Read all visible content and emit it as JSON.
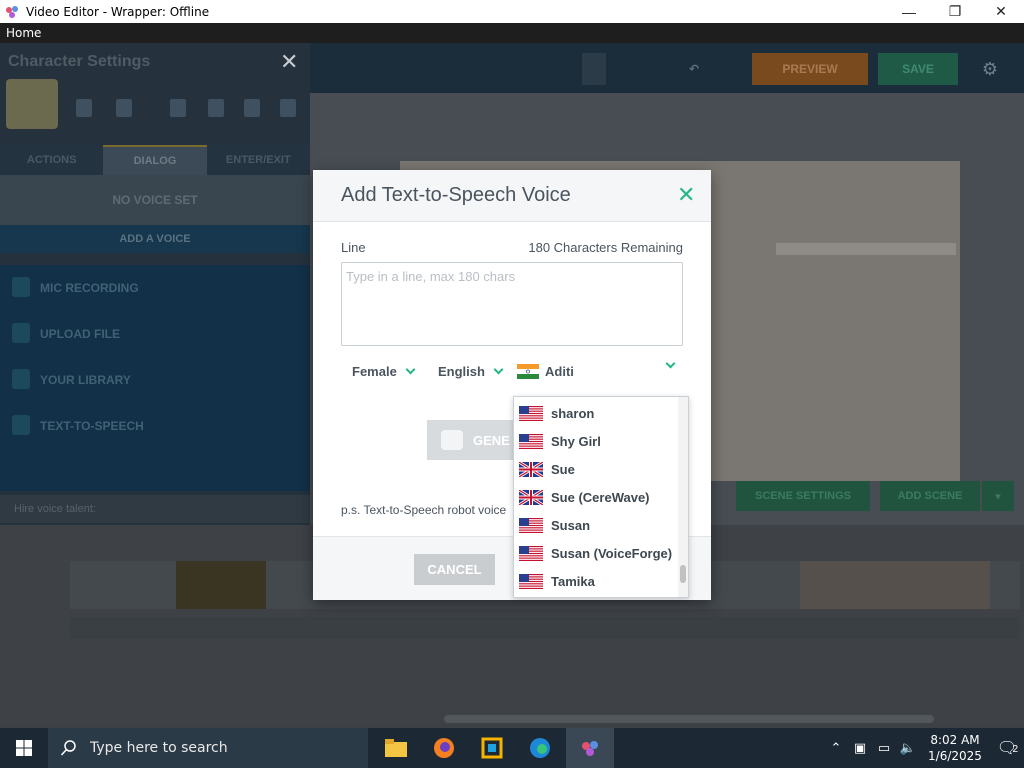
{
  "window": {
    "title": "Video Editor - Wrapper: Offline",
    "minimize": "—",
    "maximize": "❐",
    "close": "✕"
  },
  "menu": {
    "home": "Home"
  },
  "editor": {
    "panel_title": "Character Settings",
    "tabs": [
      "ACTIONS",
      "DIALOG",
      "ENTER/EXIT"
    ],
    "no_voice": "NO VOICE SET",
    "add_voice": "ADD A VOICE",
    "voice_options": [
      "MIC RECORDING",
      "UPLOAD FILE",
      "YOUR LIBRARY",
      "TEXT-TO-SPEECH"
    ],
    "talent_label": "Hire voice talent:",
    "preview_label": "PREVIEW",
    "save_label": "SAVE",
    "scene_settings": "SCENE SETTINGS",
    "add_scene": "ADD SCENE"
  },
  "modal": {
    "title": "Add Text-to-Speech Voice",
    "line_label": "Line",
    "remaining": "180 Characters Remaining",
    "line_placeholder": "Type in a line, max 180 chars",
    "gender": "Female",
    "language": "English",
    "voice": "Aditi",
    "generate_label": "GENE",
    "ps_note": "p.s. Text-to-Speech robot voice",
    "cancel": "CANCEL"
  },
  "dropdown": {
    "items": [
      {
        "label": "sharon",
        "flag": "us"
      },
      {
        "label": "Shy Girl",
        "flag": "us"
      },
      {
        "label": "Sue",
        "flag": "uk"
      },
      {
        "label": "Sue (CereWave)",
        "flag": "uk"
      },
      {
        "label": "Susan",
        "flag": "us"
      },
      {
        "label": "Susan (VoiceForge)",
        "flag": "us"
      },
      {
        "label": "Tamika",
        "flag": "us"
      }
    ]
  },
  "taskbar": {
    "search_placeholder": "Type here to search",
    "time": "8:02 AM",
    "date": "1/6/2025",
    "notifications": "2"
  },
  "colors": {
    "accent": "#26b685",
    "taskbar": "#1c2833"
  }
}
